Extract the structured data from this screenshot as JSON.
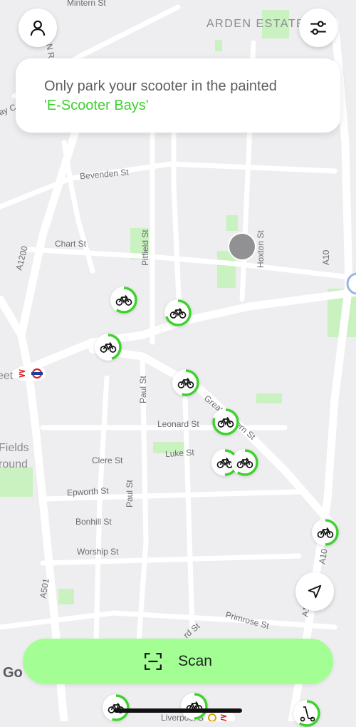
{
  "map": {
    "area_labels": [
      "ARDEN ESTATE",
      "Fields",
      "round",
      "eet"
    ],
    "street_labels": [
      "Mintern St",
      "N R",
      "Bevenden St",
      "Chart St",
      "Pitfield St",
      "Hoxton St",
      "A1200",
      "A10",
      "Paul St",
      "Leonard St",
      "Great Eastern St",
      "Luke St",
      "Clere St",
      "Epworth St",
      "Bonhill St",
      "Worship St",
      "A501",
      "Primrose St",
      "A10",
      "A1",
      "Liverpool St",
      "rd St",
      "ay C"
    ],
    "google_mark": "Go",
    "colors": {
      "accent": "#3ed12e",
      "scan_button": "#a3ff94",
      "park": "#c9f2c0"
    }
  },
  "notice": {
    "text": "Only park your scooter in the painted",
    "highlight": "'E-Scooter Bays'"
  },
  "scan": {
    "label": "Scan"
  },
  "icons": {
    "profile": "user-icon",
    "filters": "sliders-icon",
    "location": "navigation-arrow-icon",
    "scan": "scan-frame-icon",
    "vehicle": "bicycle-icon"
  },
  "vehicles": [
    {
      "type": "e-bike",
      "battery": 0.6
    },
    {
      "type": "e-bike",
      "battery": 0.7
    },
    {
      "type": "e-bike",
      "battery": 0.45
    },
    {
      "type": "e-bike",
      "battery": 0.55
    },
    {
      "type": "e-bike",
      "battery": 0.8
    },
    {
      "type": "e-bike",
      "battery": 0.5
    },
    {
      "type": "e-bike",
      "battery": 0.6
    },
    {
      "type": "e-bike",
      "battery": 0.5
    },
    {
      "type": "e-bike",
      "battery": 0.55
    },
    {
      "type": "e-bike",
      "battery": 0.5
    },
    {
      "type": "scooter",
      "battery": 0.6
    }
  ]
}
